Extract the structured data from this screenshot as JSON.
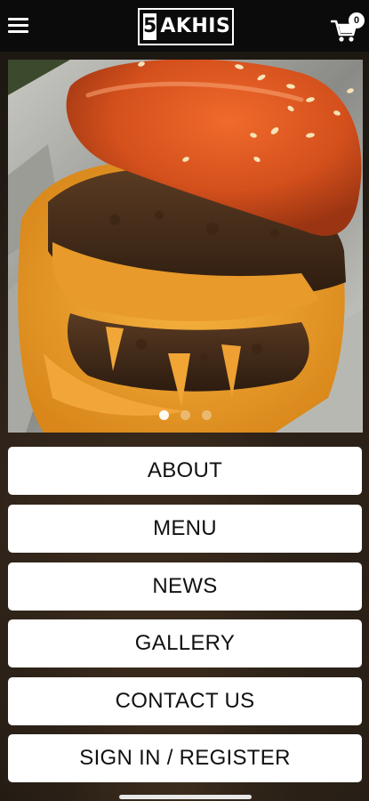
{
  "header": {
    "logo_number": "5",
    "logo_text": "AKHIS",
    "cart_count": "0"
  },
  "hero": {
    "slide_count": 3,
    "active_slide": 1
  },
  "menu": {
    "about": "ABOUT",
    "menu": "MENU",
    "news": "NEWS",
    "gallery": "GALLERY",
    "contact": "CONTACT US",
    "signin": "SIGN IN / REGISTER"
  },
  "colors": {
    "topbar": "#0b0b0b",
    "button_bg": "#ffffff",
    "button_text": "#111111"
  },
  "icons": {
    "menu": "hamburger-icon",
    "cart": "cart-icon"
  }
}
